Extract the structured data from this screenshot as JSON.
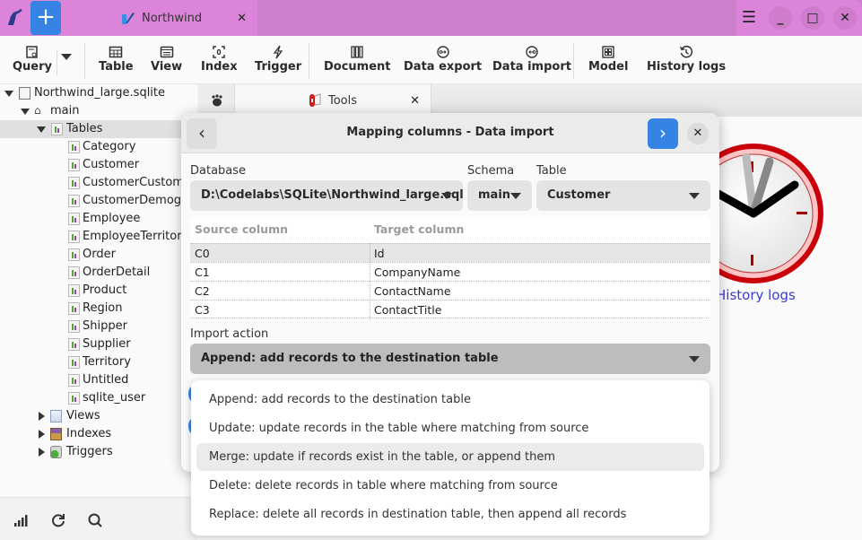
{
  "window": {
    "tabs": [
      {
        "label": "Northwind",
        "icon": "feather-icon"
      }
    ],
    "controls": {
      "menu": "☰",
      "minimize": "_",
      "maximize": "□",
      "close": "✕"
    },
    "add_tab": "+"
  },
  "toolbar": {
    "items": [
      {
        "label": "Query",
        "icon": "query-icon"
      },
      {
        "label": "Table",
        "icon": "table-icon"
      },
      {
        "label": "View",
        "icon": "view-icon"
      },
      {
        "label": "Index",
        "icon": "index-icon"
      },
      {
        "label": "Trigger",
        "icon": "trigger-icon"
      },
      {
        "label": "Document",
        "icon": "document-icon"
      },
      {
        "label": "Data export",
        "icon": "data-export-icon"
      },
      {
        "label": "Data import",
        "icon": "data-import-icon"
      },
      {
        "label": "Model",
        "icon": "model-icon"
      },
      {
        "label": "History logs",
        "icon": "history-icon"
      }
    ]
  },
  "sidebar": {
    "database": "Northwind_large.sqlite",
    "schema": "main",
    "tables_label": "Tables",
    "tables": [
      "Category",
      "Customer",
      "CustomerCustomer",
      "CustomerDemogra",
      "Employee",
      "EmployeeTerritory",
      "Order",
      "OrderDetail",
      "Product",
      "Region",
      "Shipper",
      "Supplier",
      "Territory",
      "Untitled",
      "sqlite_user"
    ],
    "views_label": "Views",
    "indexes_label": "Indexes",
    "triggers_label": "Triggers"
  },
  "content_tabs": {
    "tools_label": "Tools"
  },
  "history_link": "History logs",
  "dialog": {
    "title": "Mapping columns - Data import",
    "back": "‹",
    "next": "›",
    "close": "✕",
    "database_label": "Database",
    "database_value": "D:\\Codelabs\\SQLite\\Northwind_large.sqlite",
    "schema_label": "Schema",
    "schema_value": "main",
    "table_label": "Table",
    "table_value": "Customer",
    "mapping": {
      "headers": [
        "Source column",
        "Target column"
      ],
      "rows": [
        {
          "source": "C0",
          "target": "Id"
        },
        {
          "source": "C1",
          "target": "CompanyName"
        },
        {
          "source": "C2",
          "target": "ContactName"
        },
        {
          "source": "C3",
          "target": "ContactTitle"
        }
      ]
    },
    "import_action_label": "Import action",
    "import_action_value": "Append: add records to the destination table"
  },
  "import_action_menu": {
    "options": [
      "Append: add records to the destination table",
      "Update: update records in the table where matching from source",
      "Merge: update if records exist in the table, or append them",
      "Delete: delete records in table where matching from source",
      "Replace: delete all records in destination table, then append all records"
    ],
    "highlighted_index": 2
  },
  "colors": {
    "titlebar": "#cc7fcb",
    "titlebar_light": "#dc84d9",
    "accent": "#3584e4",
    "link": "#3a3ad6"
  }
}
